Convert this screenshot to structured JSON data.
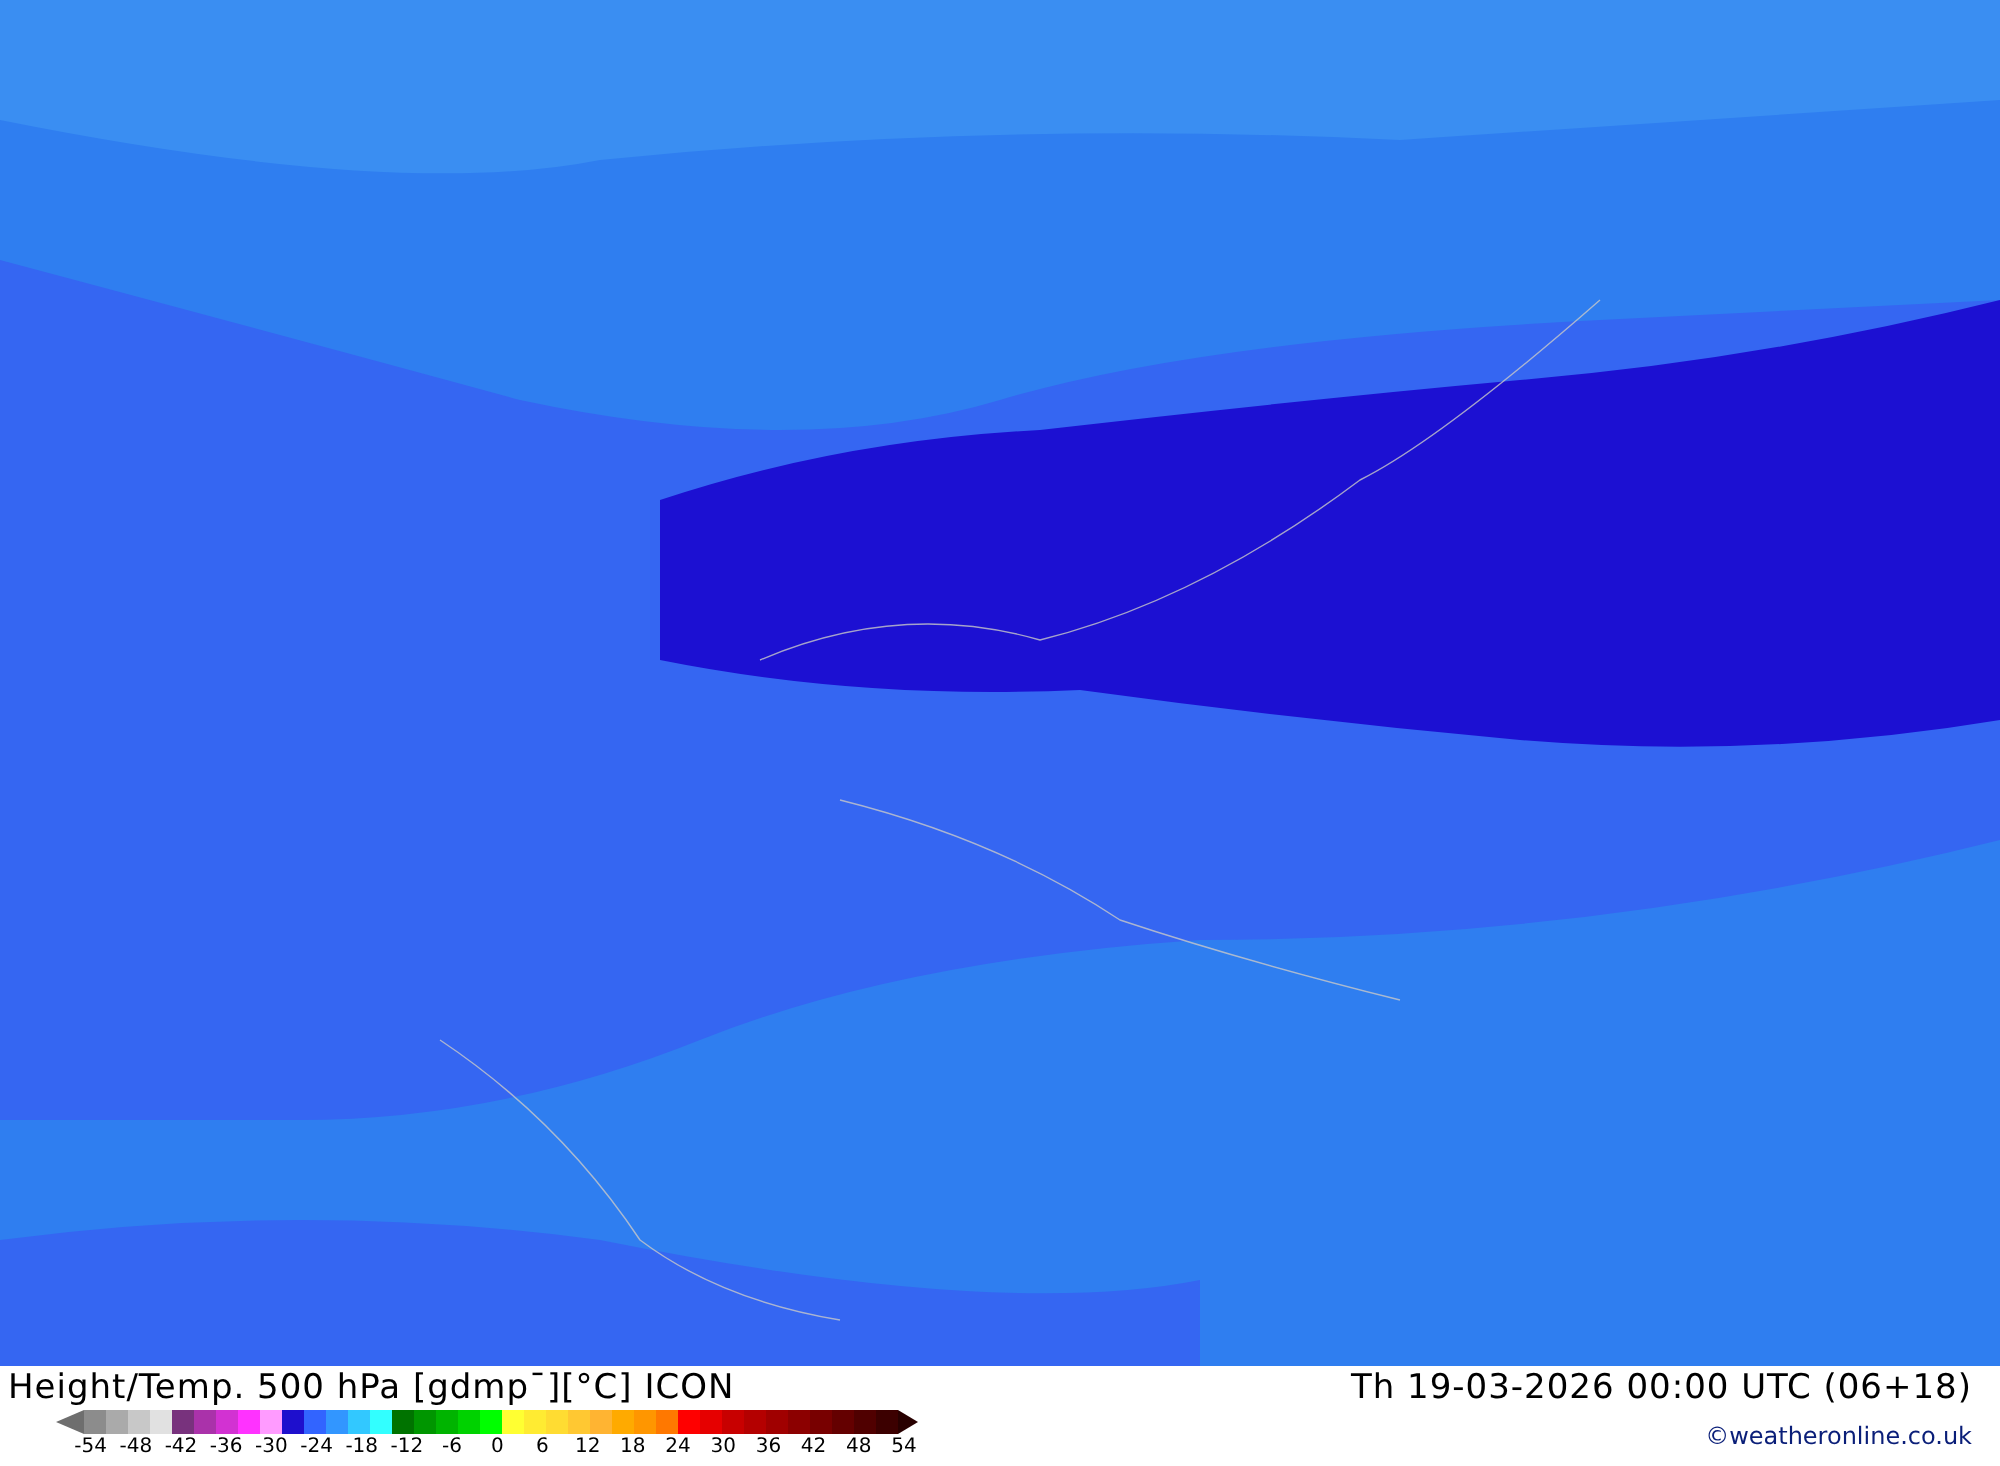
{
  "map": {
    "kind": "temperature-map"
  },
  "footer": {
    "title": "Height/Temp. 500 hPa [gdmp¯][°C] ICON",
    "valid_time": "Th 19-03-2026 00:00 UTC (06+18)",
    "copyright": "©weatheronline.co.uk",
    "legend": {
      "swatches": [
        {
          "color": "#8c8c8c"
        },
        {
          "color": "#aaaaaa"
        },
        {
          "color": "#c8c8c8"
        },
        {
          "color": "#e1e1e1"
        },
        {
          "color": "#78327d"
        },
        {
          "color": "#aa32aa"
        },
        {
          "color": "#d232d2"
        },
        {
          "color": "#ff32ff"
        },
        {
          "color": "#ff9bff"
        },
        {
          "color": "#1e0fcd"
        },
        {
          "color": "#3264ff"
        },
        {
          "color": "#3296ff"
        },
        {
          "color": "#32c8ff"
        },
        {
          "color": "#32ffff"
        },
        {
          "color": "#007300"
        },
        {
          "color": "#009600"
        },
        {
          "color": "#00b400"
        },
        {
          "color": "#00d200"
        },
        {
          "color": "#00ff00"
        },
        {
          "color": "#ffff32"
        },
        {
          "color": "#ffeb32"
        },
        {
          "color": "#ffdc32"
        },
        {
          "color": "#ffc832"
        },
        {
          "color": "#ffb432"
        },
        {
          "color": "#ffaa00"
        },
        {
          "color": "#ff9600"
        },
        {
          "color": "#ff7800"
        },
        {
          "color": "#ff0000"
        },
        {
          "color": "#e60000"
        },
        {
          "color": "#c80000"
        },
        {
          "color": "#b40000"
        },
        {
          "color": "#a00000"
        },
        {
          "color": "#8c0000"
        },
        {
          "color": "#780000"
        },
        {
          "color": "#640000"
        },
        {
          "color": "#500000"
        },
        {
          "color": "#3c0000"
        }
      ],
      "labels": [
        "-54",
        "-48",
        "-42",
        "-36",
        "-30",
        "-24",
        "-18",
        "-12",
        "-6",
        "0",
        "6",
        "12",
        "18",
        "24",
        "30",
        "36",
        "42",
        "48",
        "54"
      ]
    }
  }
}
